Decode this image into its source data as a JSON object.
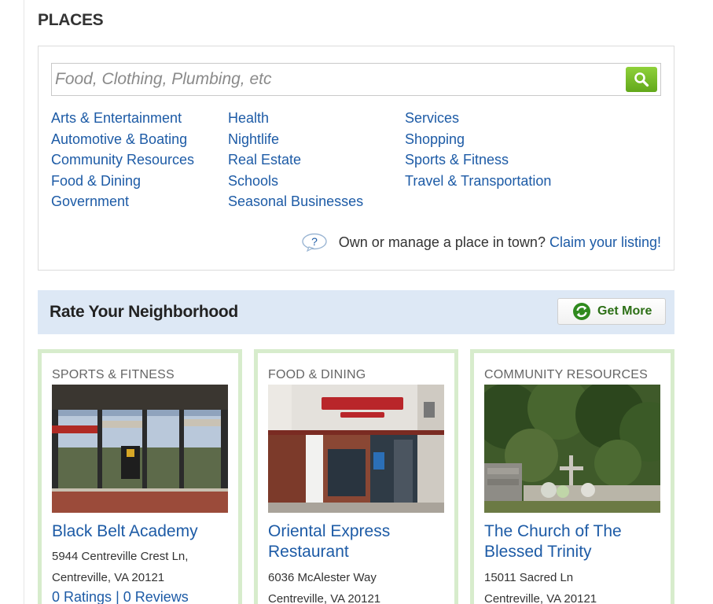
{
  "places": {
    "title": "PLACES",
    "search": {
      "placeholder": "Food, Clothing, Plumbing, etc",
      "button_icon": "search-icon"
    },
    "categories": {
      "col1": [
        "Arts & Entertainment",
        "Automotive & Boating",
        "Community Resources",
        "Food & Dining",
        "Government"
      ],
      "col2": [
        "Health",
        "Nightlife",
        "Real Estate",
        "Schools",
        "Seasonal Businesses"
      ],
      "col3": [
        "Services",
        "Shopping",
        "Sports & Fitness",
        "Travel & Transportation"
      ]
    },
    "claim_text": "Own or manage a place in town?",
    "claim_link": "Claim your listing!"
  },
  "rate": {
    "title": "Rate Your Neighborhood",
    "get_more": "Get More"
  },
  "cards": [
    {
      "category": "SPORTS & FITNESS",
      "name": "Black Belt Academy",
      "address1": "5944 Centreville Crest Ln,",
      "address2": "Centreville, VA 20121",
      "ratings": "0 Ratings",
      "reviews": "0 Reviews"
    },
    {
      "category": "FOOD & DINING",
      "name": "Oriental Express Restaurant",
      "address1": "6036 McAlester Way",
      "address2": "Centreville, VA 20121"
    },
    {
      "category": "COMMUNITY RESOURCES",
      "name": "The Church of The Blessed Trinity",
      "address1": "15011 Sacred Ln",
      "address2": "Centreville, VA 20121"
    }
  ],
  "colors": {
    "link": "#1d5ba6",
    "search_button": "#7cc02b",
    "rate_bar": "#dde8f5",
    "card_border": "#d7eccc"
  }
}
